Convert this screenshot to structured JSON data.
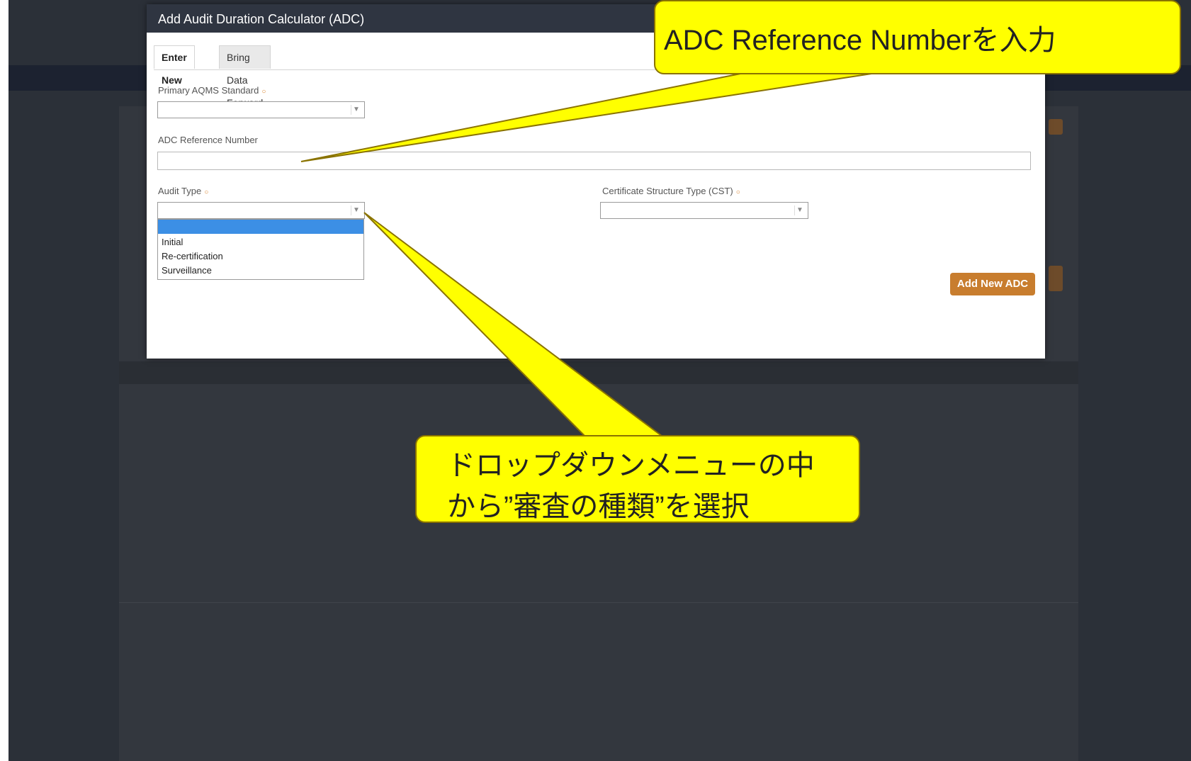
{
  "modal": {
    "title": "Add Audit Duration Calculator (ADC)",
    "tabs": [
      {
        "label": "Enter New",
        "active": true
      },
      {
        "label": "Bring Data Forward",
        "active": false
      }
    ],
    "primary_standard": {
      "label": "Primary AQMS Standard",
      "value": ""
    },
    "reference_number": {
      "label": "ADC Reference Number",
      "value": ""
    },
    "audit_type": {
      "label": "Audit Type",
      "options": [
        "",
        "Initial",
        "Re-certification",
        "Surveillance"
      ],
      "highlighted": ""
    },
    "cst": {
      "label": "Certificate Structure Type (CST)",
      "value": ""
    },
    "add_button": "Add New ADC",
    "required_marker": "○"
  },
  "callouts": {
    "reference": "ADC Reference Numberを入力",
    "audit_type": "ドロップダウンメニューの中から”審査の種類”を選択"
  },
  "colors": {
    "accent": "#c87d2e",
    "header": "#2f3541",
    "highlight": "#3c8fe5",
    "callout": "#ffff00"
  }
}
